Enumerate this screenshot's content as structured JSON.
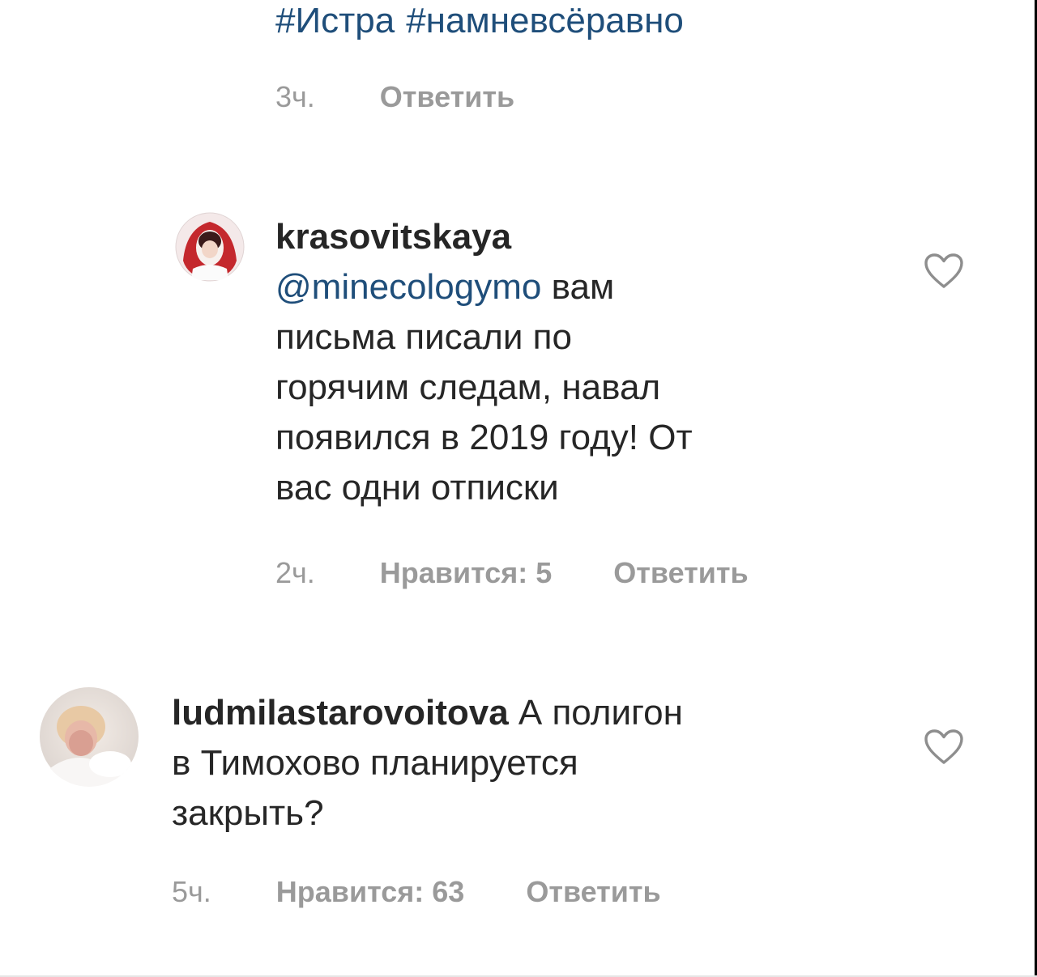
{
  "top_comment": {
    "hashtags": [
      "#Истра",
      "#намневсёравно"
    ],
    "time": "3ч.",
    "reply_label": "Ответить"
  },
  "comments": [
    {
      "username": "krasovitskaya",
      "mention": "@minecologymo",
      "text": "вам письма писали по горячим следам, навал появился в 2019 году! От вас одни отписки",
      "lines": [
        "вам",
        "письма писали по",
        "горячим следам, навал",
        "появился в 2019 году! От",
        "вас одни отписки"
      ],
      "time": "2ч.",
      "likes_label": "Нравится: 5",
      "reply_label": "Ответить",
      "like_icon": "heart-outline-icon"
    },
    {
      "username": "ludmilastarovoitova",
      "text": "А полигон в Тимохово планируется закрыть?",
      "lines": [
        "А полигон",
        "в Тимохово планируется",
        "закрыть?"
      ],
      "time": "5ч.",
      "likes_label": "Нравится: 63",
      "reply_label": "Ответить",
      "like_icon": "heart-outline-icon"
    }
  ],
  "colors": {
    "link": "#1f4e7a",
    "text": "#262626",
    "meta": "#9a9a9a"
  }
}
